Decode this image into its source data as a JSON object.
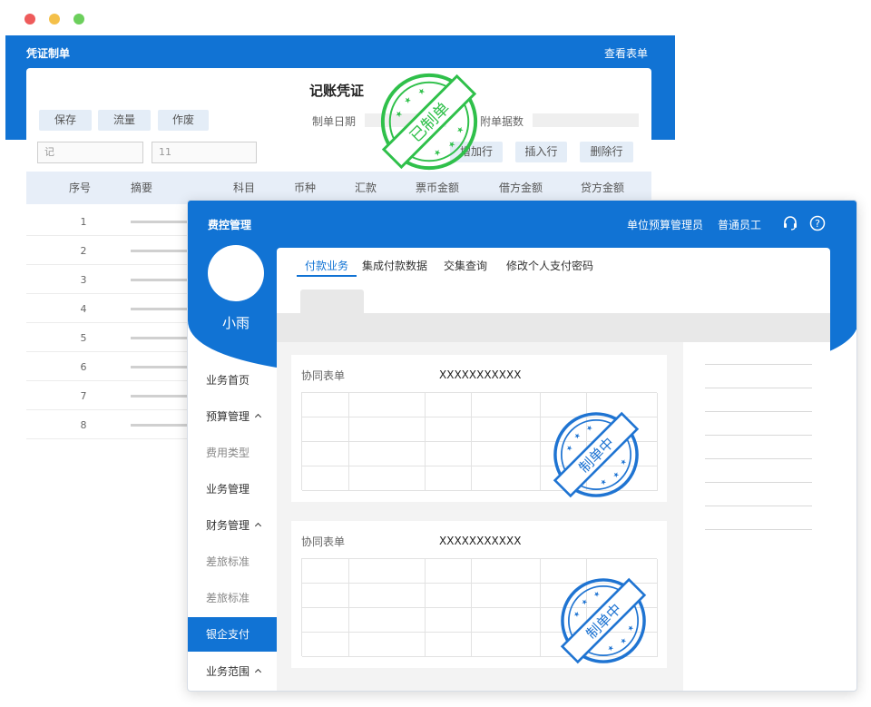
{
  "window_controls": {
    "close": "#ee5b5b",
    "minimize": "#f4c04a",
    "maximize": "#6ccf5c"
  },
  "colors": {
    "brand_blue": "#1173d4",
    "stamp_green": "#2fc04a",
    "stamp_blue": "#1f74d2"
  },
  "voucher_window": {
    "header_title": "凭证制单",
    "header_link": "查看表单",
    "title": "记账凭证",
    "buttons": [
      "保存",
      "流量",
      "作废"
    ],
    "date_label": "制单日期",
    "attachments_label": "附单据数",
    "inputs": [
      {
        "value": "记"
      },
      {
        "value": "11"
      }
    ],
    "row_buttons": [
      "增加行",
      "插入行",
      "删除行"
    ],
    "columns": [
      "序号",
      "摘要",
      "科目",
      "币种",
      "汇款",
      "票币金额",
      "借方金额",
      "贷方金额"
    ],
    "rows": [
      "1",
      "2",
      "3",
      "4",
      "5",
      "6",
      "7",
      "8"
    ],
    "stamp": {
      "text": "已制单",
      "icon": "approved-stamp-icon"
    }
  },
  "expense_window": {
    "header_title": "费控管理",
    "header_right": {
      "role": "单位预算管理员",
      "user_type": "普通员工",
      "headset_icon": "headset-icon",
      "help_icon": "help-icon"
    },
    "user": {
      "name": "小雨",
      "avatar_icon": "avatar-icon"
    },
    "menu": [
      {
        "label": "业务首页",
        "type": "item"
      },
      {
        "label": "预算管理",
        "type": "group",
        "icon": "chevron-up-icon"
      },
      {
        "label": "费用类型",
        "type": "sub"
      },
      {
        "label": "业务管理",
        "type": "item"
      },
      {
        "label": "财务管理",
        "type": "group",
        "icon": "chevron-up-icon"
      },
      {
        "label": "差旅标准",
        "type": "sub"
      },
      {
        "label": "差旅标准",
        "type": "sub"
      },
      {
        "label": "银企支付",
        "type": "active"
      },
      {
        "label": "业务范围",
        "type": "group",
        "icon": "chevron-up-icon"
      }
    ],
    "tabs": [
      "付款业务",
      "集成付款数据",
      "交集查询",
      "修改个人支付密码"
    ],
    "active_tab": 0,
    "forms": [
      {
        "label": "协同表单",
        "value": "XXXXXXXXXXX",
        "stamp": "制单中"
      },
      {
        "label": "协同表单",
        "value": "XXXXXXXXXXX",
        "stamp": "制单中"
      }
    ]
  }
}
